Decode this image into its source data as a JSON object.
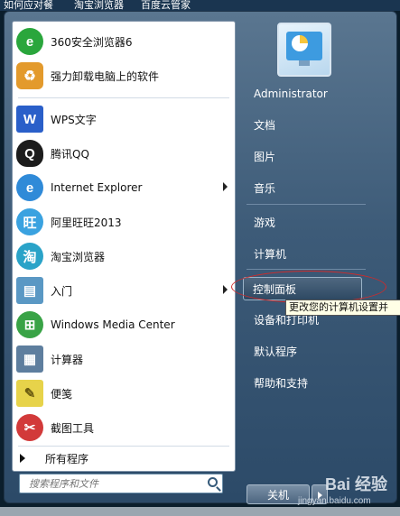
{
  "top_bar": {
    "items": [
      "如何应对餐",
      "淘宝浏览器",
      "百度云管家"
    ]
  },
  "pinned": [
    {
      "label": "360安全浏览器6",
      "icon": "360-browser-icon",
      "color": "#2aa63c"
    },
    {
      "label": "强力卸载电脑上的软件",
      "icon": "uninstall-box-icon",
      "color": "#e39a2c"
    }
  ],
  "recent": [
    {
      "label": "WPS文字",
      "icon": "wps-writer-icon",
      "color": "#2a5fc9"
    },
    {
      "label": "腾讯QQ",
      "icon": "qq-penguin-icon",
      "color": "#1c1c1c"
    },
    {
      "label": "Internet Explorer",
      "icon": "internet-explorer-icon",
      "color": "#2f8ad8"
    },
    {
      "label": "阿里旺旺2013",
      "icon": "aliwangwang-icon",
      "color": "#3aa2e0"
    },
    {
      "label": "淘宝浏览器",
      "icon": "taobao-browser-icon",
      "color": "#2aa3c8"
    },
    {
      "label": "入门",
      "icon": "getting-started-icon",
      "color": "#5a98c4"
    },
    {
      "label": "Windows Media Center",
      "icon": "windows-media-center-icon",
      "color": "#39a346"
    },
    {
      "label": "计算器",
      "icon": "calculator-icon",
      "color": "#5e7e9e"
    },
    {
      "label": "便笺",
      "icon": "sticky-notes-icon",
      "color": "#e7d34a"
    },
    {
      "label": "截图工具",
      "icon": "snipping-tool-icon",
      "color": "#d23a3a"
    }
  ],
  "all_programs": "所有程序",
  "search": {
    "placeholder": "搜索程序和文件"
  },
  "right_menu": {
    "user": "Administrator",
    "items": [
      "文档",
      "图片",
      "音乐",
      "游戏",
      "计算机",
      "控制面板",
      "设备和打印机",
      "默认程序",
      "帮助和支持"
    ]
  },
  "tooltip": "更改您的计算机设置并",
  "shutdown": {
    "label": "关机"
  },
  "watermark": {
    "brand": "Bai 经验",
    "url": "jingyan.baidu.com"
  },
  "colors": {
    "highlight_annotation": "#d02a2a"
  }
}
